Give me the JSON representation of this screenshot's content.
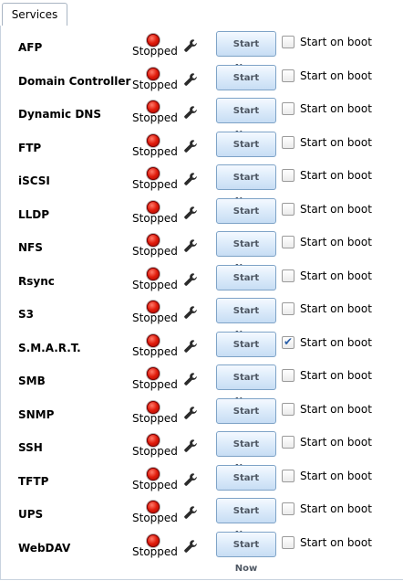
{
  "tab": {
    "label": "Services"
  },
  "services": [
    {
      "name": "AFP",
      "status": "Stopped",
      "button": "Start Now",
      "boot_label": "Start on boot",
      "boot_checked": false
    },
    {
      "name": "Domain Controller",
      "status": "Stopped",
      "button": "Start Now",
      "boot_label": "Start on boot",
      "boot_checked": false
    },
    {
      "name": "Dynamic DNS",
      "status": "Stopped",
      "button": "Start Now",
      "boot_label": "Start on boot",
      "boot_checked": false
    },
    {
      "name": "FTP",
      "status": "Stopped",
      "button": "Start Now",
      "boot_label": "Start on boot",
      "boot_checked": false
    },
    {
      "name": "iSCSI",
      "status": "Stopped",
      "button": "Start Now",
      "boot_label": "Start on boot",
      "boot_checked": false
    },
    {
      "name": "LLDP",
      "status": "Stopped",
      "button": "Start Now",
      "boot_label": "Start on boot",
      "boot_checked": false
    },
    {
      "name": "NFS",
      "status": "Stopped",
      "button": "Start Now",
      "boot_label": "Start on boot",
      "boot_checked": false
    },
    {
      "name": "Rsync",
      "status": "Stopped",
      "button": "Start Now",
      "boot_label": "Start on boot",
      "boot_checked": false
    },
    {
      "name": "S3",
      "status": "Stopped",
      "button": "Start Now",
      "boot_label": "Start on boot",
      "boot_checked": false
    },
    {
      "name": "S.M.A.R.T.",
      "status": "Stopped",
      "button": "Start Now",
      "boot_label": "Start on boot",
      "boot_checked": true
    },
    {
      "name": "SMB",
      "status": "Stopped",
      "button": "Start Now",
      "boot_label": "Start on boot",
      "boot_checked": false
    },
    {
      "name": "SNMP",
      "status": "Stopped",
      "button": "Start Now",
      "boot_label": "Start on boot",
      "boot_checked": false
    },
    {
      "name": "SSH",
      "status": "Stopped",
      "button": "Start Now",
      "boot_label": "Start on boot",
      "boot_checked": false
    },
    {
      "name": "TFTP",
      "status": "Stopped",
      "button": "Start Now",
      "boot_label": "Start on boot",
      "boot_checked": false
    },
    {
      "name": "UPS",
      "status": "Stopped",
      "button": "Start Now",
      "boot_label": "Start on boot",
      "boot_checked": false
    },
    {
      "name": "WebDAV",
      "status": "Stopped",
      "button": "Start Now",
      "boot_label": "Start on boot",
      "boot_checked": false
    }
  ],
  "icons": {
    "status": "stopped-status-icon",
    "settings": "wrench-icon",
    "checked": "checkmark-icon"
  },
  "colors": {
    "stopped": "#e01b0b",
    "button_border": "#7ea3c7",
    "tab_border": "#a9b5c3"
  }
}
